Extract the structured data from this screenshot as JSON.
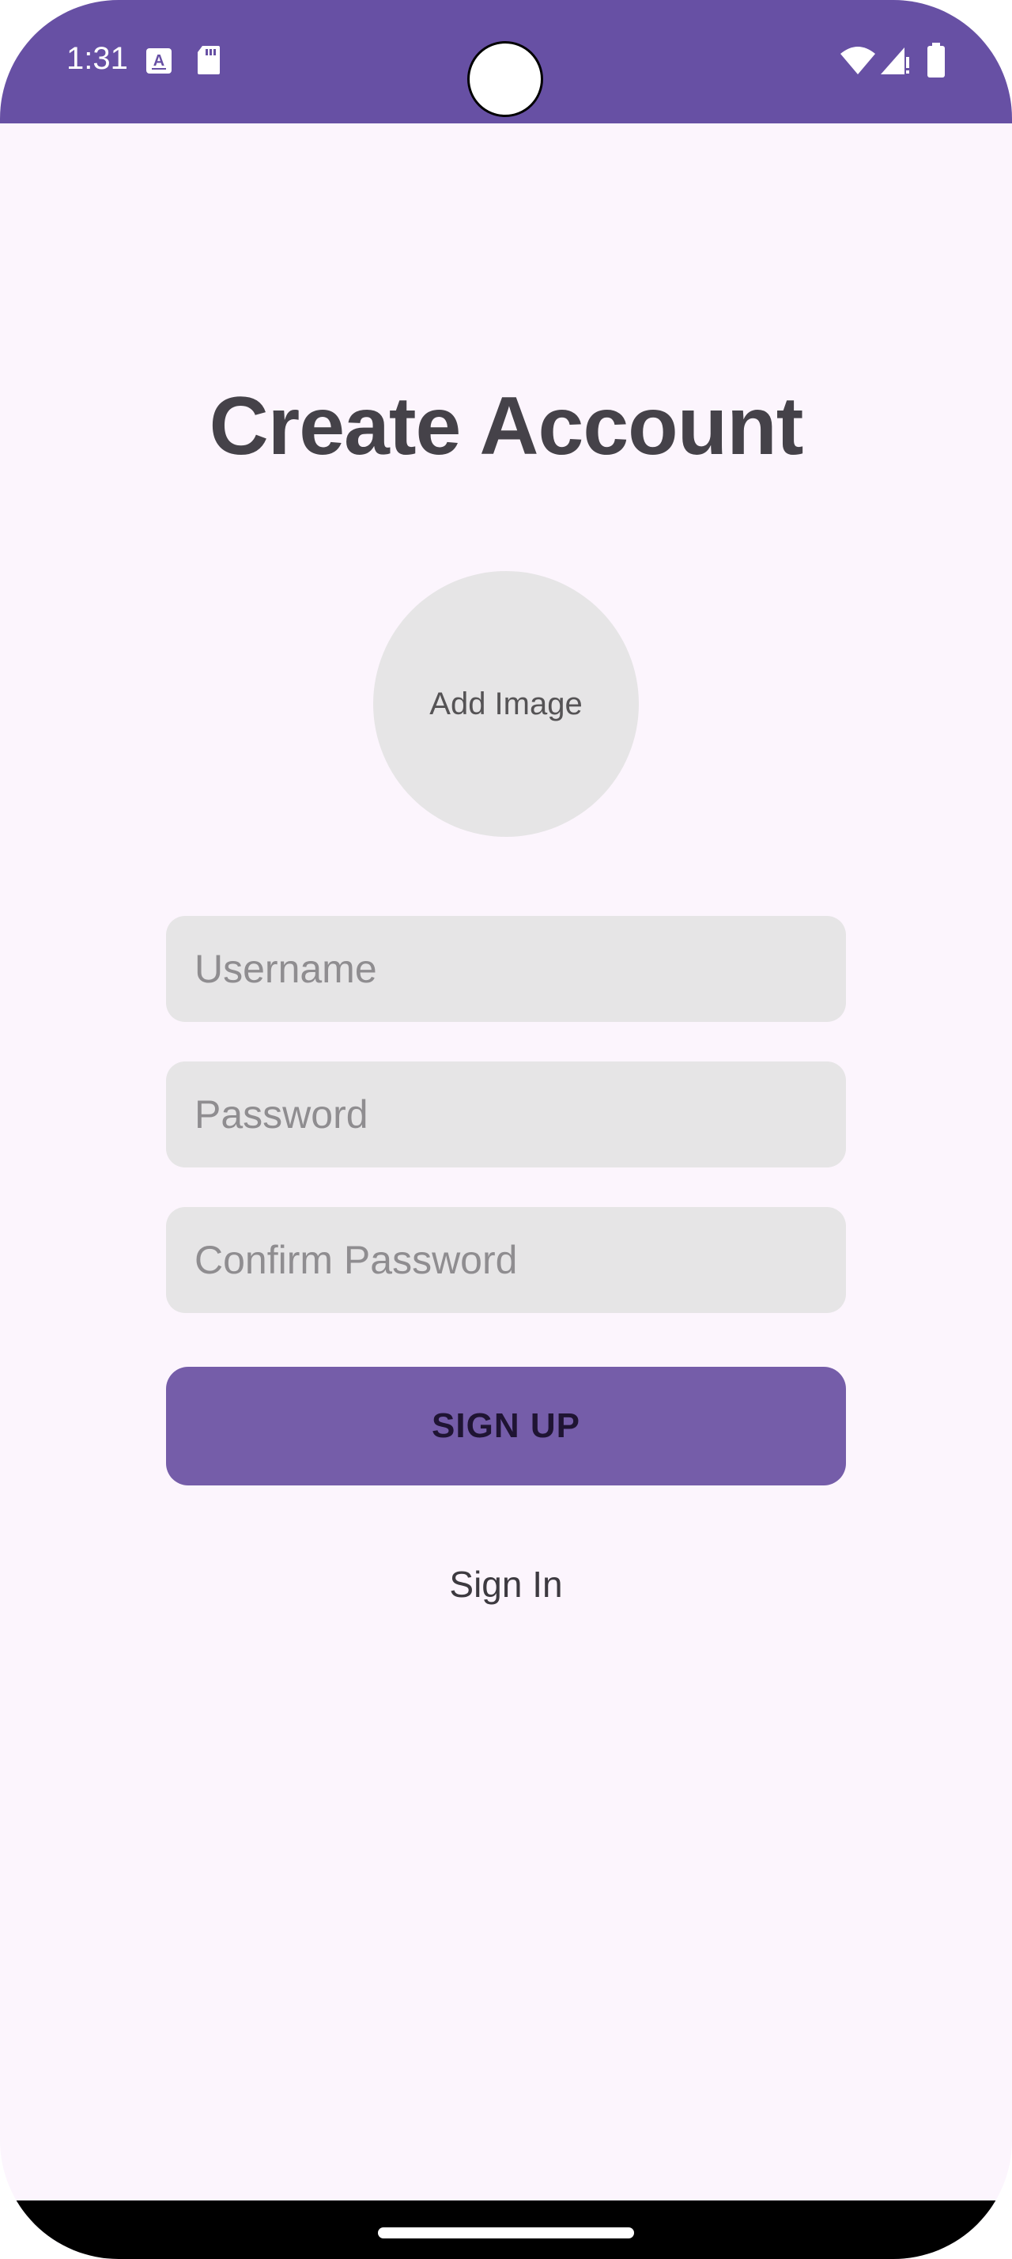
{
  "status_bar": {
    "time": "1:31",
    "background_color": "#6750a4",
    "icons": [
      "a11y-font-icon",
      "sd-card-icon",
      "wifi-icon",
      "cellular-signal-icon",
      "battery-icon"
    ]
  },
  "page": {
    "title": "Create Account",
    "background_color": "#fcf5fd"
  },
  "avatar": {
    "label": "Add Image"
  },
  "form": {
    "username_placeholder": "Username",
    "password_placeholder": "Password",
    "confirm_password_placeholder": "Confirm Password",
    "signup_label": "SIGN UP",
    "signin_label": "Sign In",
    "accent_color": "#755da9"
  }
}
